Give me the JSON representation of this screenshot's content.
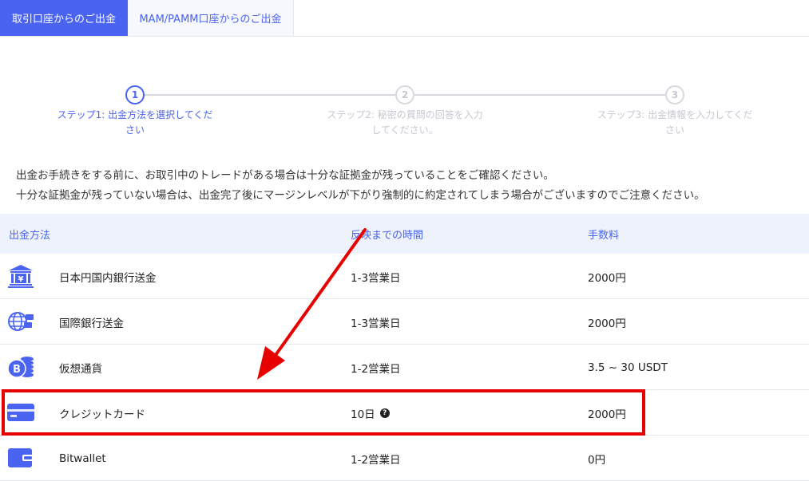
{
  "tabs": [
    {
      "label": "取引口座からのご出金",
      "active": true
    },
    {
      "label": "MAM/PAMM口座からのご出金",
      "active": false
    }
  ],
  "steps": [
    {
      "number": "1",
      "line1": "ステップ1: 出金方法を選択してくだ",
      "line2": "さい",
      "active": true
    },
    {
      "number": "2",
      "line1": "ステップ2: 秘密の質問の回答を入力",
      "line2": "してください。",
      "active": false
    },
    {
      "number": "3",
      "line1": "ステップ3: 出金情報を入力してくだ",
      "line2": "さい",
      "active": false
    }
  ],
  "notice": {
    "line1": "出金お手続きをする前に、お取引中のトレードがある場合は十分な証拠金が残っていることをご確認ください。",
    "line2": "十分な証拠金が残っていない場合は、出金完了後にマージンレベルが下がり強制的に約定されてしまう場合がございますのでご注意ください。"
  },
  "table": {
    "headers": {
      "method": "出金方法",
      "time": "反映までの時間",
      "fee": "手数料"
    },
    "rows": [
      {
        "icon": "bank-yen-icon",
        "method": "日本円国内銀行送金",
        "time": "1-3営業日",
        "fee": "2000円"
      },
      {
        "icon": "globe-transfer-icon",
        "method": "国際銀行送金",
        "time": "1-3営業日",
        "fee": "2000円"
      },
      {
        "icon": "bitcoin-coins-icon",
        "method": "仮想通貨",
        "time": "1-2営業日",
        "fee": "3.5 ~ 30 USDT"
      },
      {
        "icon": "credit-card-icon",
        "method": "クレジットカード",
        "time": "10日",
        "fee": "2000円",
        "help": "?"
      },
      {
        "icon": "wallet-icon",
        "method": "Bitwallet",
        "time": "1-2営業日",
        "fee": "0円"
      }
    ]
  },
  "colors": {
    "accent": "#4a63f0",
    "highlight": "#e60000",
    "header_bg": "#eef2fd"
  }
}
